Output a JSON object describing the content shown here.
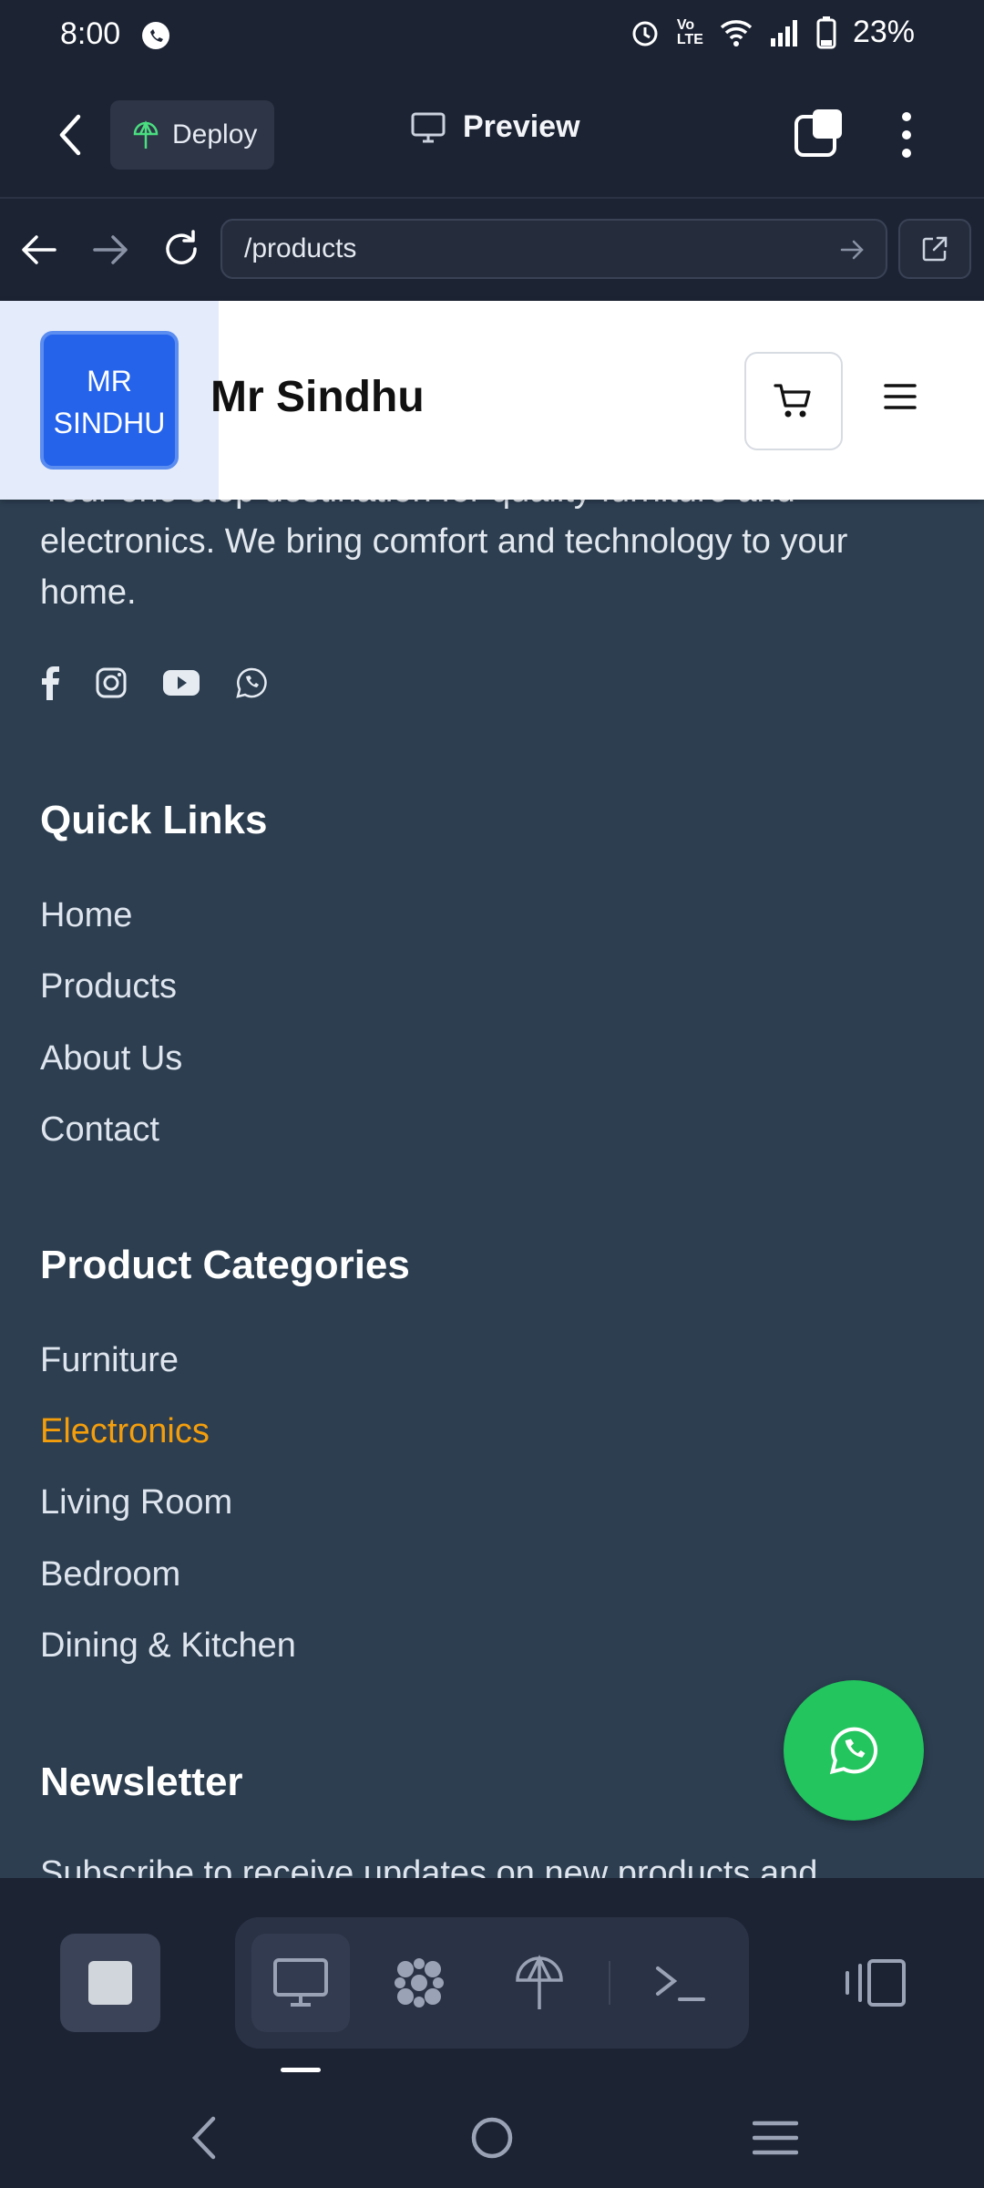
{
  "status": {
    "time": "8:00",
    "battery": "23%"
  },
  "appbar": {
    "deploy_label": "Deploy",
    "preview_label": "Preview"
  },
  "urlbar": {
    "url": "/products"
  },
  "site": {
    "logo_line1": "MR",
    "logo_line2": "SINDHU",
    "brand": "Mr Sindhu"
  },
  "footer": {
    "intro": "Your one-stop destination for quality furniture and electronics. We bring comfort and technology to your home.",
    "quick_links_title": "Quick Links",
    "quick_links": [
      "Home",
      "Products",
      "About Us",
      "Contact"
    ],
    "categories_title": "Product Categories",
    "categories": [
      "Furniture",
      "Electronics",
      "Living Room",
      "Bedroom",
      "Dining & Kitchen"
    ],
    "newsletter_title": "Newsletter",
    "newsletter_text": "Subscribe to receive updates on new products and"
  },
  "colors": {
    "accent_link": "#f59e0b",
    "whatsapp": "#22c55e",
    "logo_blue": "#2563eb"
  }
}
